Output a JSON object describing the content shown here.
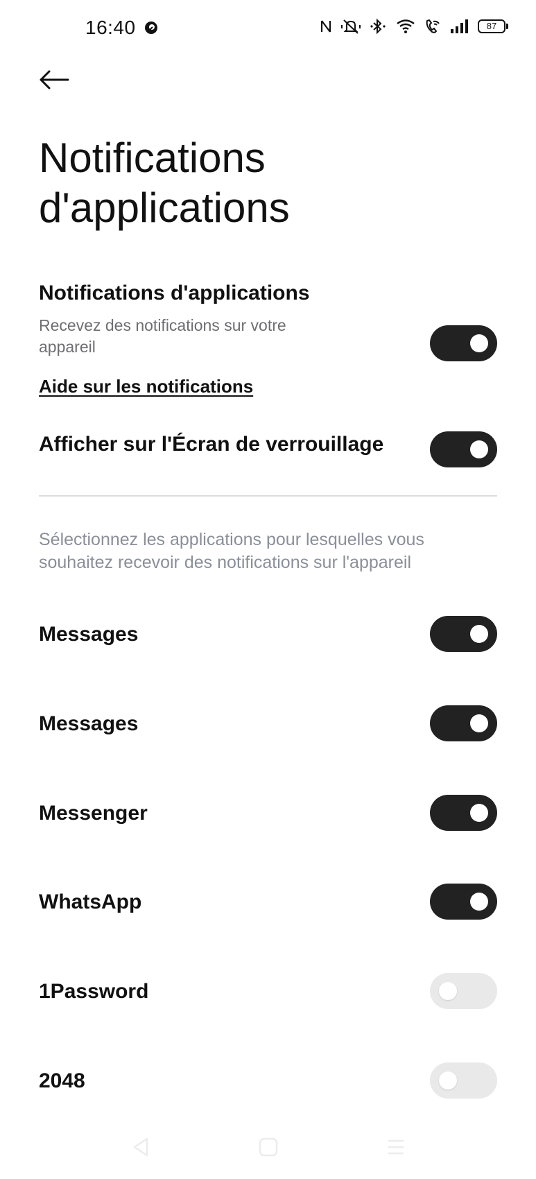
{
  "status_bar": {
    "time": "16:40",
    "battery": "87",
    "icons": [
      "app-notification-icon",
      "nfc-icon",
      "silent-icon",
      "bluetooth-icon",
      "wifi-icon",
      "wifi-calling-icon",
      "signal-icon",
      "battery-icon"
    ]
  },
  "header": {
    "back_icon": "arrow-left-icon",
    "title": "Notifications d'applications"
  },
  "main_setting": {
    "title": "Notifications d'applications",
    "subtitle": "Recevez des notifications sur votre appareil",
    "toggle_on": true
  },
  "help_link": "Aide sur les notifications",
  "lock_screen": {
    "label": "Afficher sur l'Écran de verrouillage",
    "toggle_on": true
  },
  "section_description": "Sélectionnez les applications pour lesquelles vous souhaitez recevoir des notifications sur l'appareil",
  "apps": [
    {
      "name": "Messages",
      "enabled": true
    },
    {
      "name": "Messages",
      "enabled": true
    },
    {
      "name": "Messenger",
      "enabled": true
    },
    {
      "name": "WhatsApp",
      "enabled": true
    },
    {
      "name": "1Password",
      "enabled": false
    },
    {
      "name": "2048",
      "enabled": false
    }
  ],
  "nav_bar": {
    "icons": [
      "back-nav-icon",
      "home-nav-icon",
      "recents-nav-icon"
    ]
  },
  "colors": {
    "toggle_on": "#222222",
    "toggle_off": "#e9e9ea",
    "secondary_text": "#6e6e72",
    "section_text": "#8a8f99"
  }
}
